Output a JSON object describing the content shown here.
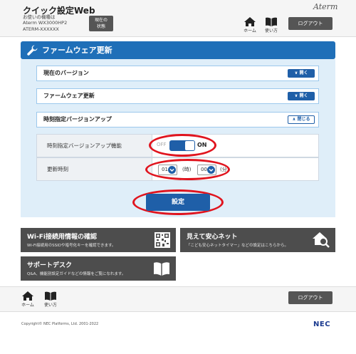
{
  "header": {
    "title": "クイック設定Web",
    "device_prefix": "お使いの機種は",
    "model": "Aterm  WX3000HP2",
    "ssid": "ATERM-XXXXXX",
    "status_btn_line1": "現在の",
    "status_btn_line2": "状態",
    "brand": "Aterm",
    "home_label": "ホーム",
    "help_label": "使い方",
    "logout_label": "ログアウト"
  },
  "section": {
    "title": "ファームウェア更新"
  },
  "accordions": [
    {
      "label": "現在のバージョン",
      "button": "開く"
    },
    {
      "label": "ファームウェア更新",
      "button": "開く"
    },
    {
      "label": "時刻指定バージョンアップ",
      "button": "閉じる"
    }
  ],
  "settings": {
    "toggle_row_label": "時刻指定バージョンアップ機能",
    "toggle_off": "OFF",
    "toggle_on": "ON",
    "toggle_state": "ON",
    "time_row_label": "更新時刻",
    "hour_value": "01",
    "hour_unit": "(時)",
    "minute_value": "00",
    "minute_unit": "(分"
  },
  "submit_label": "設定",
  "tiles": [
    {
      "title": "Wi-Fi接続用情報の確認",
      "desc": "Wi-Fi接続用のSSIDや暗号化キーを確認できます。",
      "icon": "qr-code-icon"
    },
    {
      "title": "見えて安心ネット",
      "desc": "「こども安心ネットタイマー」などの設定はこちらから。",
      "icon": "home-search-icon"
    },
    {
      "title": "サポートデスク",
      "desc": "Q&A、機能別設定ガイドなどの情報をご覧になれます。",
      "icon": "book-icon"
    }
  ],
  "footer": {
    "home_label": "ホーム",
    "help_label": "使い方",
    "logout_label": "ログアウト",
    "copyright": "Copyright© NEC Platforms, Ltd. 2001-2022",
    "logo": "NEC"
  },
  "colors": {
    "primary": "#1f6fb8",
    "highlight": "#e0141e",
    "tile": "#4d4d4d"
  }
}
